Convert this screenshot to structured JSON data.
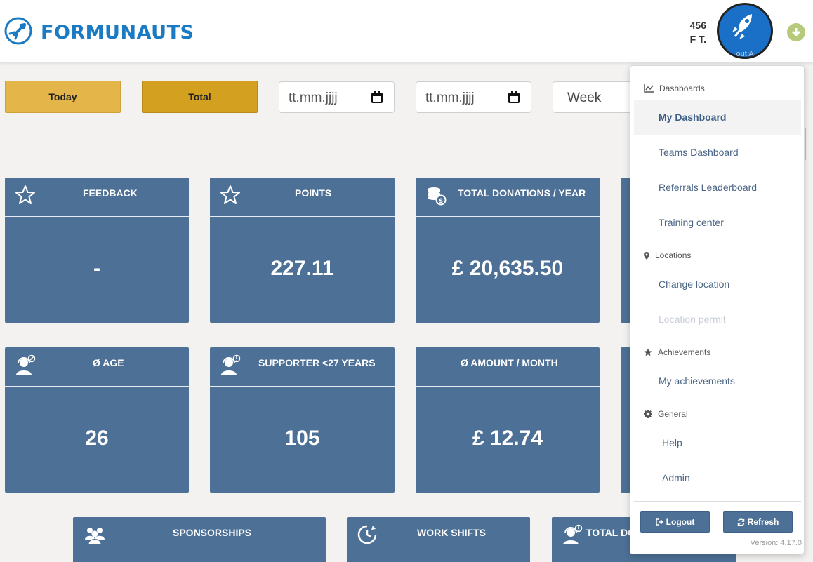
{
  "app": {
    "brand": "FORMUNAUTS",
    "user_line1": "456",
    "user_line2": "F T.",
    "avatar_caption": "out A",
    "accent_color": "#1a7bc4",
    "card_color": "#4d7096"
  },
  "filters": {
    "today_label": "Today",
    "total_label": "Total",
    "date_from_placeholder": "tt.mm.jjjj",
    "date_to_placeholder": "tt.mm.jjjj",
    "period_value": "Week"
  },
  "cards_row1": [
    {
      "title": "FEEDBACK",
      "value": "-",
      "icon": "star-icon"
    },
    {
      "title": "POINTS",
      "value": "227.11",
      "icon": "star-icon"
    },
    {
      "title": "TOTAL DONATIONS / YEAR",
      "value": "£ 20,635.50",
      "icon": "coins-icon"
    }
  ],
  "cards_row2": [
    {
      "title": "Ø AGE",
      "value": "26",
      "icon": "agent-icon"
    },
    {
      "title": "SUPPORTER <27 YEARS",
      "value": "105",
      "icon": "agent-alert-icon"
    },
    {
      "title": "Ø AMOUNT / MONTH",
      "value": "£ 12.74",
      "icon": ""
    }
  ],
  "cards_row3": [
    {
      "title": "SPONSORSHIPS",
      "icon": "users-icon"
    },
    {
      "title": "WORK SHIFTS",
      "icon": "clock-icon"
    },
    {
      "title": "TOTAL DO",
      "icon": "agent-alert-icon"
    }
  ],
  "menu": {
    "sections": {
      "dashboards": "Dashboards",
      "locations": "Locations",
      "achievements": "Achievements",
      "general": "General"
    },
    "items": {
      "my_dashboard": "My Dashboard",
      "teams_dashboard": "Teams Dashboard",
      "referrals_leaderboard": "Referrals Leaderboard",
      "training_center": "Training center",
      "change_location": "Change location",
      "location_permit": "Location permit",
      "my_achievements": "My achievements",
      "help": "Help",
      "admin": "Admin"
    },
    "logout_label": "Logout",
    "refresh_label": "Refresh",
    "version": "Version: 4.17.0"
  }
}
